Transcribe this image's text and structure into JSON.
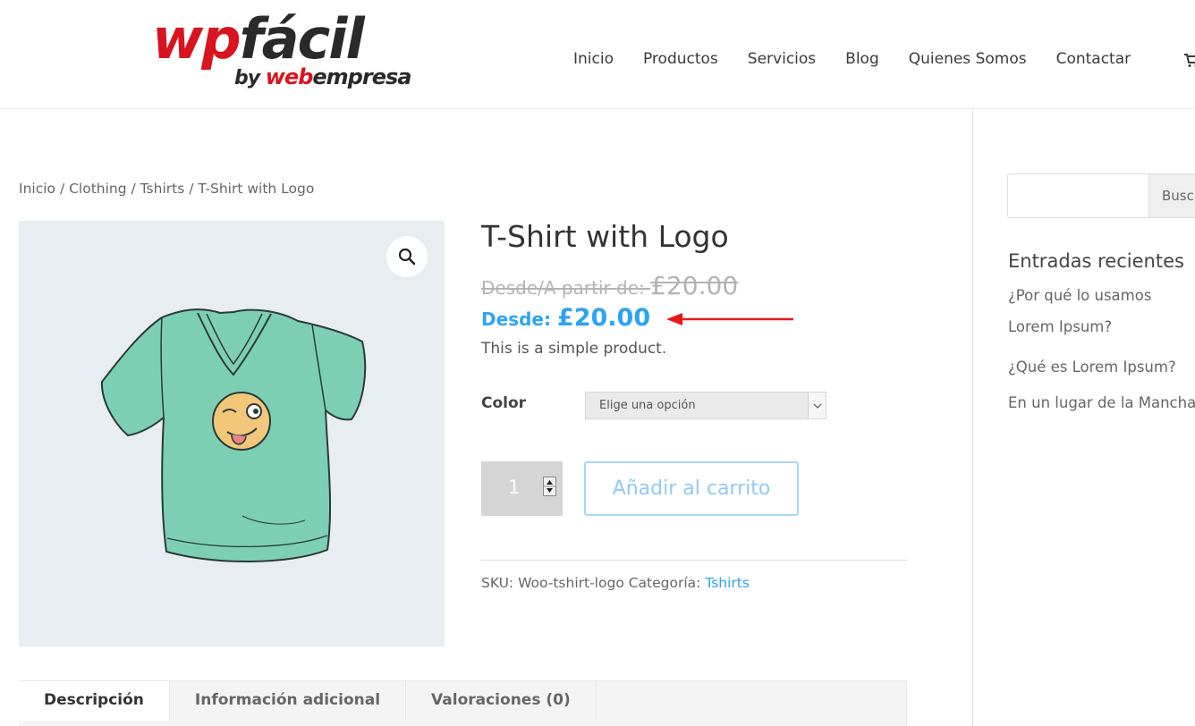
{
  "brand": {
    "logo_main_red": "wp",
    "logo_main_dark": "fácil",
    "logo_by": "by ",
    "logo_web": "web",
    "logo_empresa": "empresa",
    "brand_red": "#d8141e",
    "brand_dark": "#2a2a2a"
  },
  "nav": {
    "items": [
      "Inicio",
      "Productos",
      "Servicios",
      "Blog",
      "Quienes Somos",
      "Contactar"
    ],
    "cart_icon": "cart-icon"
  },
  "breadcrumb": {
    "items": [
      "Inicio",
      "Clothing",
      "Tshirts"
    ],
    "current": "T-Shirt with Logo",
    "separator": " / "
  },
  "product": {
    "title": "T-Shirt with Logo",
    "old_price_prefix": "Desde/A partir de: ",
    "old_price": "£20.00",
    "new_price_prefix": "Desde: ",
    "new_price": "£20.00",
    "short_description": "This is a simple product.",
    "color_label": "Color",
    "color_select_value": "Elige una opción",
    "quantity": "1",
    "add_to_cart_label": "Añadir al carrito",
    "sku_label": "SKU: ",
    "sku_value": "Woo-tshirt-logo",
    "category_label": " Categoría: ",
    "category_value": "Tshirts",
    "accent_color": "#2ea3f2",
    "zoom_icon": "zoom-icon",
    "annotation_arrow_color": "#e8151b"
  },
  "tabs": [
    {
      "label": "Descripción",
      "active": true
    },
    {
      "label": "Información adicional",
      "active": false
    },
    {
      "label": "Valoraciones (0)",
      "active": false
    }
  ],
  "sidebar": {
    "search_button_label": "Buscar",
    "search_input_value": "",
    "recent_posts_title": "Entradas recientes",
    "recent_posts": [
      "¿Por qué lo usamos",
      "Lorem Ipsum?",
      "¿Qué es Lorem Ipsum?",
      "En un lugar de la Mancha"
    ]
  }
}
